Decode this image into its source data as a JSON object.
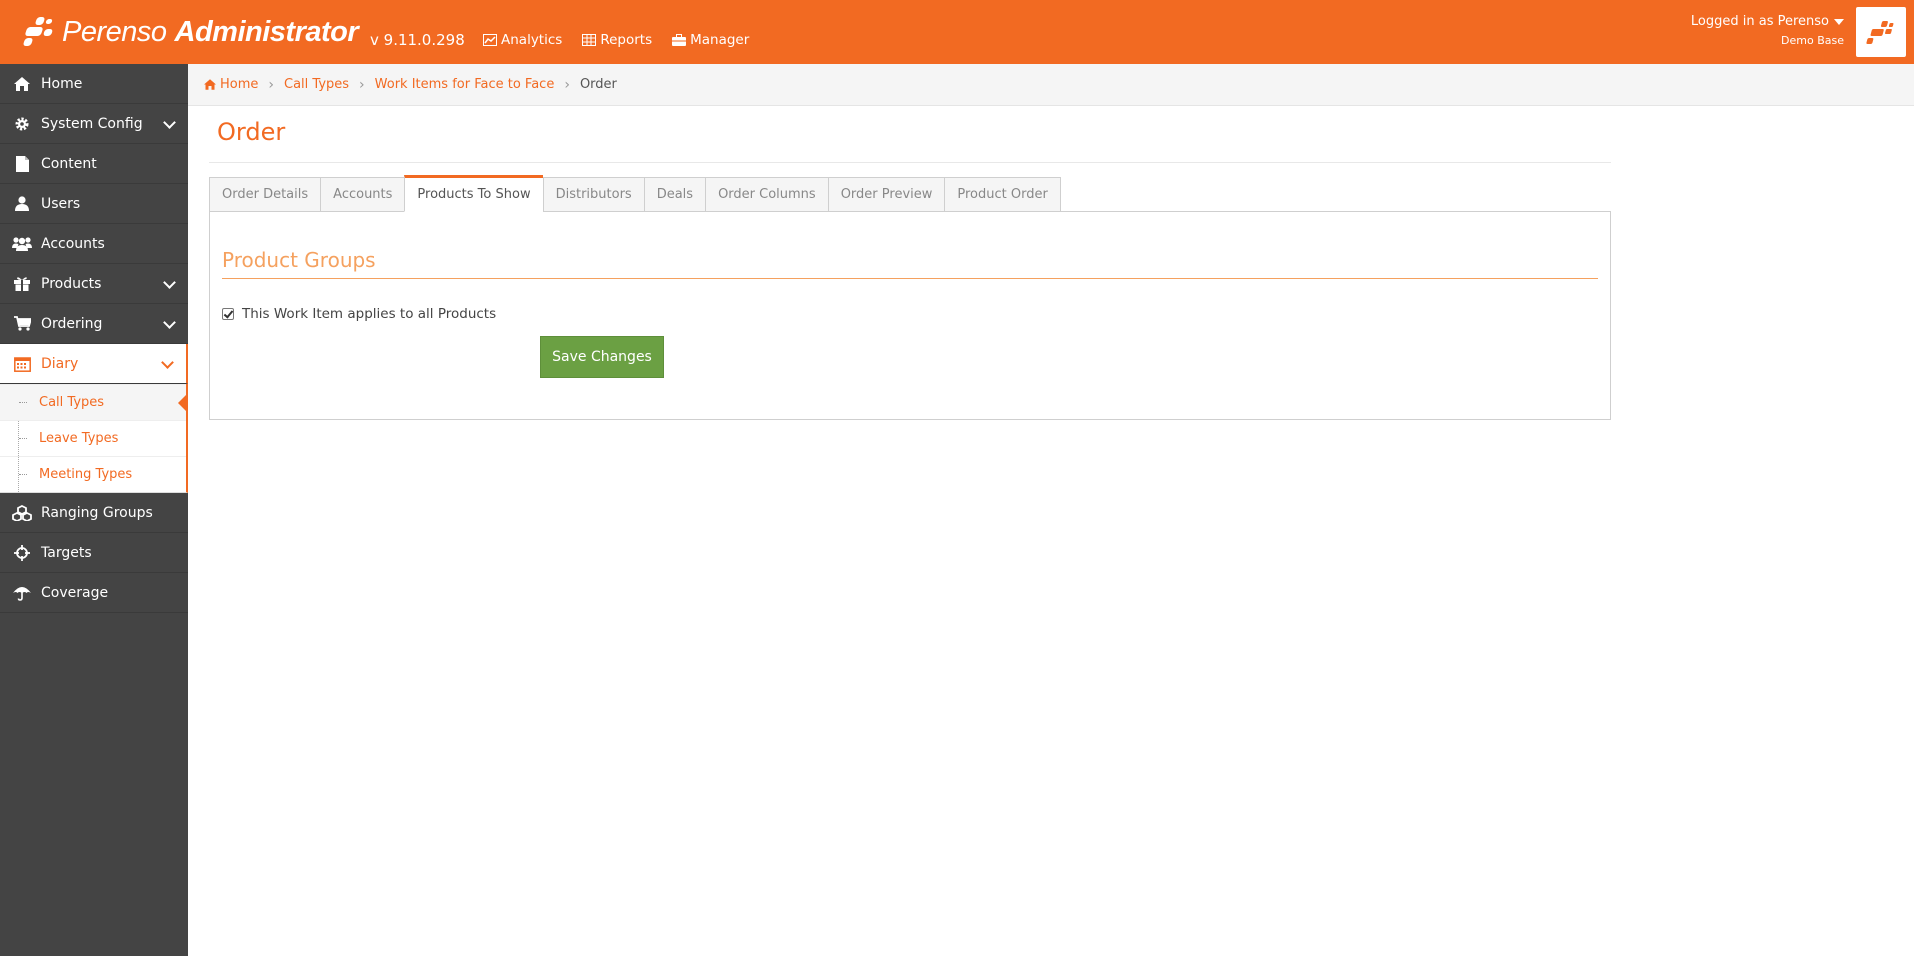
{
  "header": {
    "brand_light": "Perenso",
    "brand_bold": "Administrator",
    "version": "v 9.11.0.298",
    "nav": [
      {
        "label": "Analytics",
        "icon": "chart-icon"
      },
      {
        "label": "Reports",
        "icon": "table-icon"
      },
      {
        "label": "Manager",
        "icon": "briefcase-icon"
      }
    ],
    "user": {
      "logged_in": "Logged in as Perenso",
      "database": "Demo Base"
    },
    "colors": {
      "brand": "#f26a22",
      "sidebar": "#444444",
      "save_button": "#6ba043"
    }
  },
  "sidebar": {
    "items": [
      {
        "label": "Home",
        "icon": "home-icon"
      },
      {
        "label": "System Config",
        "icon": "gear-icon"
      },
      {
        "label": "Content",
        "icon": "file-icon"
      },
      {
        "label": "Users",
        "icon": "user-icon"
      },
      {
        "label": "Accounts",
        "icon": "users-icon"
      },
      {
        "label": "Products",
        "icon": "gift-icon"
      },
      {
        "label": "Ordering",
        "icon": "cart-icon"
      },
      {
        "label": "Diary",
        "icon": "calendar-icon"
      },
      {
        "label": "Ranging Groups",
        "icon": "cubes-icon"
      },
      {
        "label": "Targets",
        "icon": "crosshairs-icon"
      },
      {
        "label": "Coverage",
        "icon": "umbrella-icon"
      }
    ],
    "diary_sub": [
      {
        "label": "Call Types"
      },
      {
        "label": "Leave Types"
      },
      {
        "label": "Meeting Types"
      }
    ]
  },
  "breadcrumb": {
    "home": "Home",
    "call_types": "Call Types",
    "work_items": "Work Items for Face to Face",
    "current": "Order"
  },
  "page": {
    "title": "Order",
    "tabs": [
      {
        "label": "Order Details"
      },
      {
        "label": "Accounts"
      },
      {
        "label": "Products To Show"
      },
      {
        "label": "Distributors"
      },
      {
        "label": "Deals"
      },
      {
        "label": "Order Columns"
      },
      {
        "label": "Order Preview"
      },
      {
        "label": "Product Order"
      }
    ],
    "section_title": "Product Groups",
    "checkbox_label": "This Work Item applies to all Products",
    "save_label": "Save Changes"
  }
}
